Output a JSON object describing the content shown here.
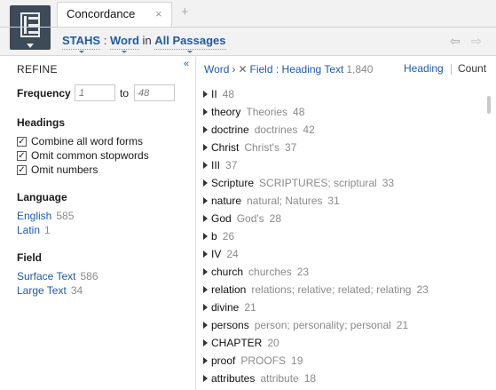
{
  "tab": {
    "title": "Concordance",
    "close": "×",
    "add": "+"
  },
  "reference": {
    "resource": "STAHS",
    "colon": " : ",
    "type": "Word",
    "in": " in ",
    "range": "All Passages"
  },
  "nav": {
    "back": "⇦",
    "forward": "⇨"
  },
  "sidebar": {
    "title": "REFINE",
    "collapse": "«",
    "frequency": {
      "label": "Frequency",
      "min_placeholder": "1",
      "to": "to",
      "max_placeholder": "48"
    },
    "headings": {
      "label": "Headings",
      "options": [
        {
          "label": "Combine all word forms",
          "checked": true
        },
        {
          "label": "Omit common stopwords",
          "checked": true
        },
        {
          "label": "Omit numbers",
          "checked": true
        }
      ]
    },
    "language": {
      "label": "Language",
      "items": [
        {
          "label": "English",
          "count": "585"
        },
        {
          "label": "Latin",
          "count": "1"
        }
      ]
    },
    "field": {
      "label": "Field",
      "items": [
        {
          "label": "Surface Text",
          "count": "586"
        },
        {
          "label": "Large Text",
          "count": "34"
        }
      ]
    }
  },
  "main": {
    "crumbs": {
      "word": "Word",
      "sep": "›",
      "remove": "✕",
      "field": "Field : Heading Text",
      "count": "1,840"
    },
    "sort": {
      "heading": "Heading",
      "count": "Count"
    },
    "rows": [
      {
        "head": "II",
        "forms": "",
        "count": "48"
      },
      {
        "head": "theory",
        "forms": "Theories",
        "count": "48"
      },
      {
        "head": "doctrine",
        "forms": "doctrines",
        "count": "42"
      },
      {
        "head": "Christ",
        "forms": "Christ's",
        "count": "37"
      },
      {
        "head": "III",
        "forms": "",
        "count": "37"
      },
      {
        "head": "Scripture",
        "forms": "SCRIPTURES; scriptural",
        "count": "33"
      },
      {
        "head": "nature",
        "forms": "natural; Natures",
        "count": "31"
      },
      {
        "head": "God",
        "forms": "God's",
        "count": "28"
      },
      {
        "head": "b",
        "forms": "",
        "count": "26"
      },
      {
        "head": "IV",
        "forms": "",
        "count": "24"
      },
      {
        "head": "church",
        "forms": "churches",
        "count": "23"
      },
      {
        "head": "relation",
        "forms": "relations; relative; related; relating",
        "count": "23"
      },
      {
        "head": "divine",
        "forms": "",
        "count": "21"
      },
      {
        "head": "persons",
        "forms": "person; personality; personal",
        "count": "21"
      },
      {
        "head": "CHAPTER",
        "forms": "",
        "count": "20"
      },
      {
        "head": "proof",
        "forms": "PROOFS",
        "count": "19"
      },
      {
        "head": "attributes",
        "forms": "attribute",
        "count": "18"
      }
    ]
  }
}
